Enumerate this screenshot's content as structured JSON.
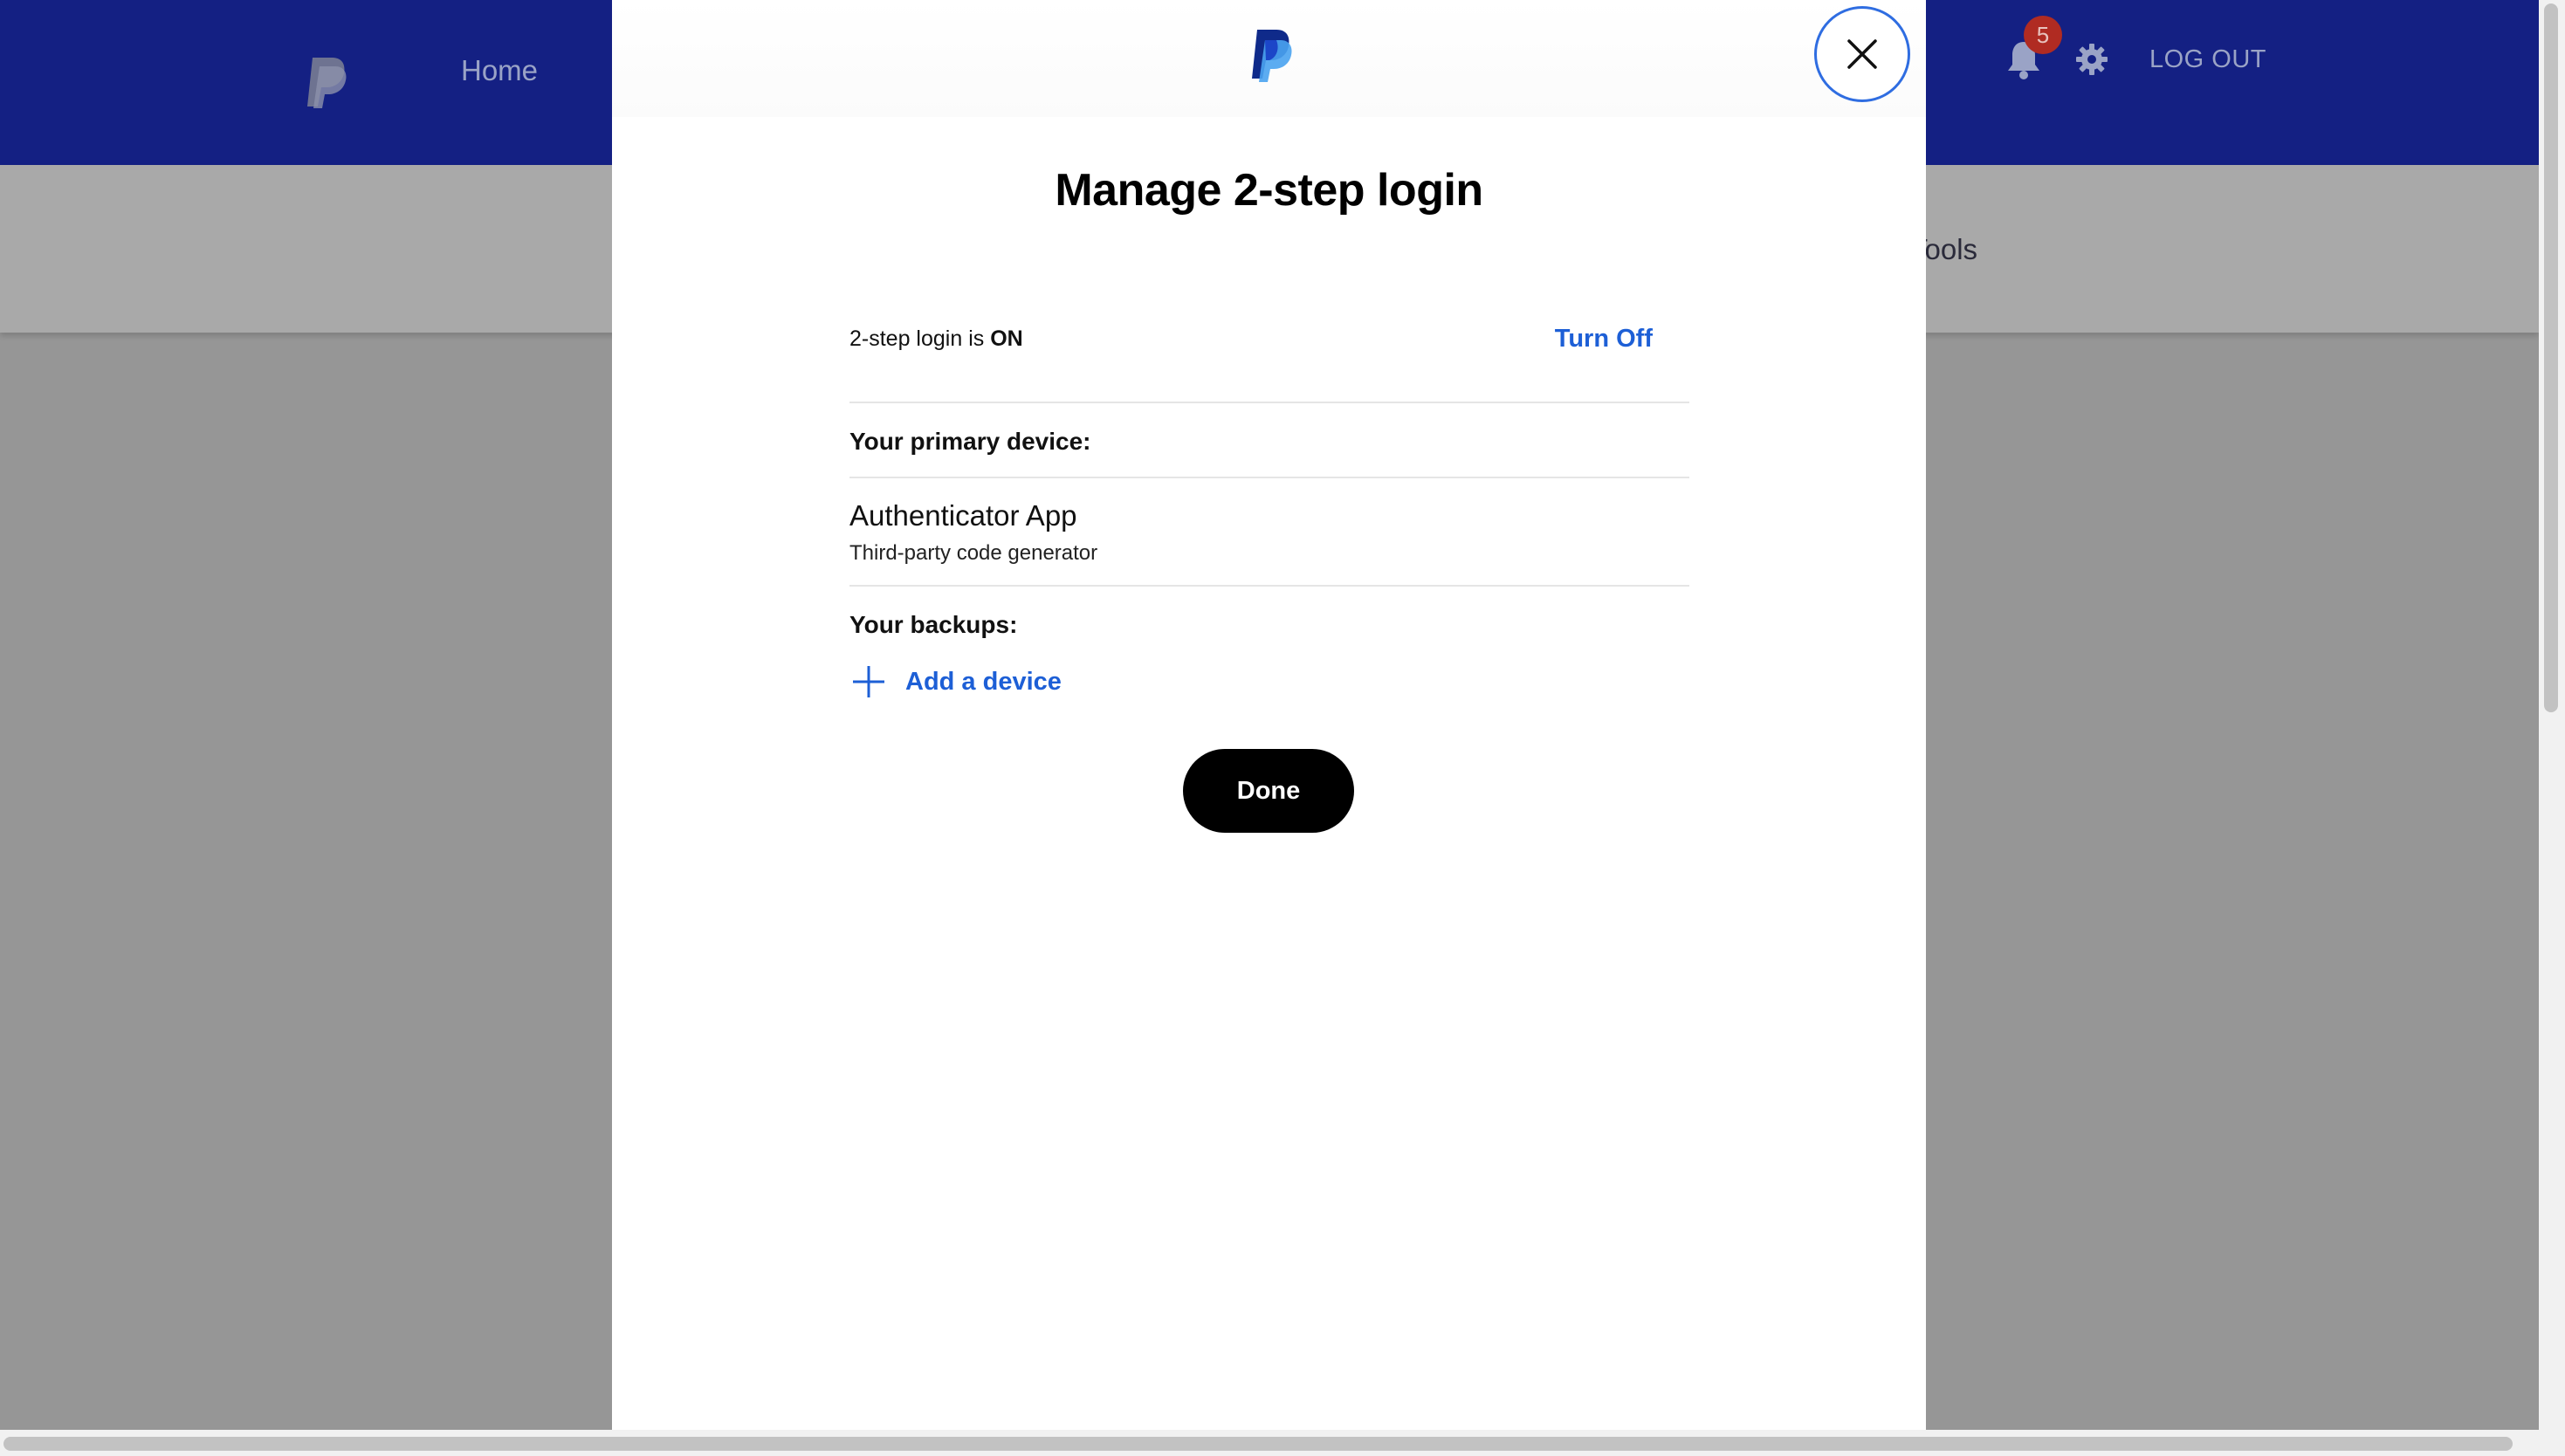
{
  "background": {
    "nav_home": "Home",
    "notification_count": "5",
    "logout_label": "LOG OUT",
    "subnav_partial": "Tools",
    "colors": {
      "topbar": "#142083",
      "badge": "#b02b22"
    }
  },
  "modal": {
    "title": "Manage 2-step login",
    "status_prefix": "2-step login is ",
    "status_value": "ON",
    "turn_off_label": "Turn Off",
    "primary_device_label": "Your primary device:",
    "primary_device": {
      "name": "Authenticator App",
      "description": "Third-party code generator"
    },
    "backups_label": "Your backups:",
    "add_device_label": "Add a device",
    "done_label": "Done",
    "colors": {
      "link": "#1d5fd6",
      "close_border": "#2f6de1",
      "done_bg": "#000000"
    }
  }
}
